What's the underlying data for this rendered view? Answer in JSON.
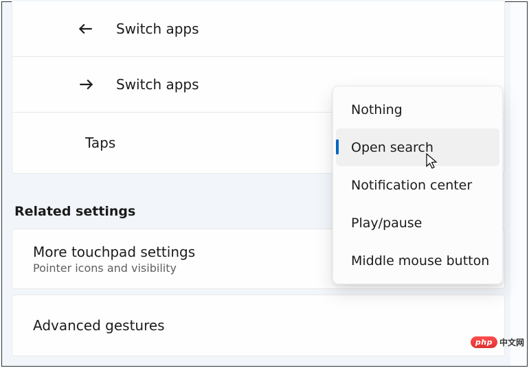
{
  "gestures": {
    "items": [
      {
        "label": "Switch apps",
        "icon": "arrow-left"
      },
      {
        "label": "Switch apps",
        "icon": "arrow-right"
      },
      {
        "label": "Taps",
        "icon": null
      }
    ]
  },
  "section_header": "Related settings",
  "related": [
    {
      "title": "More touchpad settings",
      "subtitle": "Pointer icons and visibility"
    },
    {
      "title": "Advanced gestures",
      "subtitle": ""
    }
  ],
  "dropdown": {
    "options": [
      {
        "label": "Nothing"
      },
      {
        "label": "Open search"
      },
      {
        "label": "Notification center"
      },
      {
        "label": "Play/pause"
      },
      {
        "label": "Middle mouse button"
      }
    ],
    "selected_index": 1
  },
  "watermark": {
    "brand": "php",
    "text": "中文网"
  }
}
